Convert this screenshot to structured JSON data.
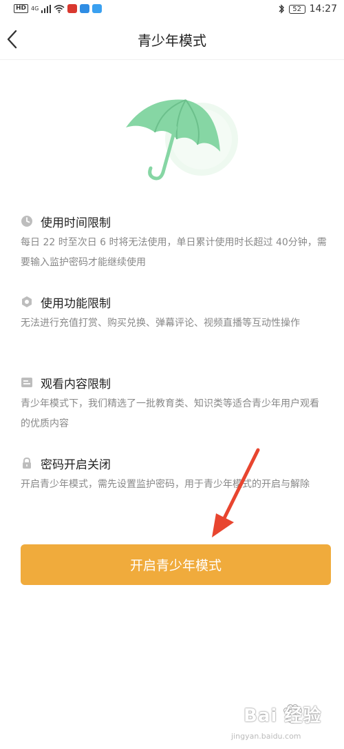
{
  "status_bar": {
    "hd_label": "HD",
    "network_label": "4G",
    "battery": "52",
    "time": "14:27"
  },
  "header": {
    "title": "青少年模式"
  },
  "sections": [
    {
      "icon": "clock-icon",
      "title": "使用时间限制",
      "body": "每日 22 时至次日 6 时将无法使用，单日累计使用时长超过 40分钟，需要输入监护密码才能继续使用"
    },
    {
      "icon": "hexagon-icon",
      "title": "使用功能限制",
      "body": "无法进行充值打赏、购买兑换、弹幕评论、视频直播等互动性操作"
    },
    {
      "icon": "content-icon",
      "title": "观看内容限制",
      "body": "青少年模式下，我们精选了一批教育类、知识类等适合青少年用户观看的优质内容"
    },
    {
      "icon": "lock-icon",
      "title": "密码开启关闭",
      "body": "开启青少年模式，需先设置监护密码，用于青少年模式的开启与解除"
    }
  ],
  "cta": {
    "label": "开启青少年模式"
  },
  "watermark": {
    "text": "Bai 经验",
    "url": "jingyan.baidu.com"
  },
  "colors": {
    "accent": "#f0ab3c",
    "umbrella": "#7fd4a0",
    "arrow": "#e8452f"
  }
}
